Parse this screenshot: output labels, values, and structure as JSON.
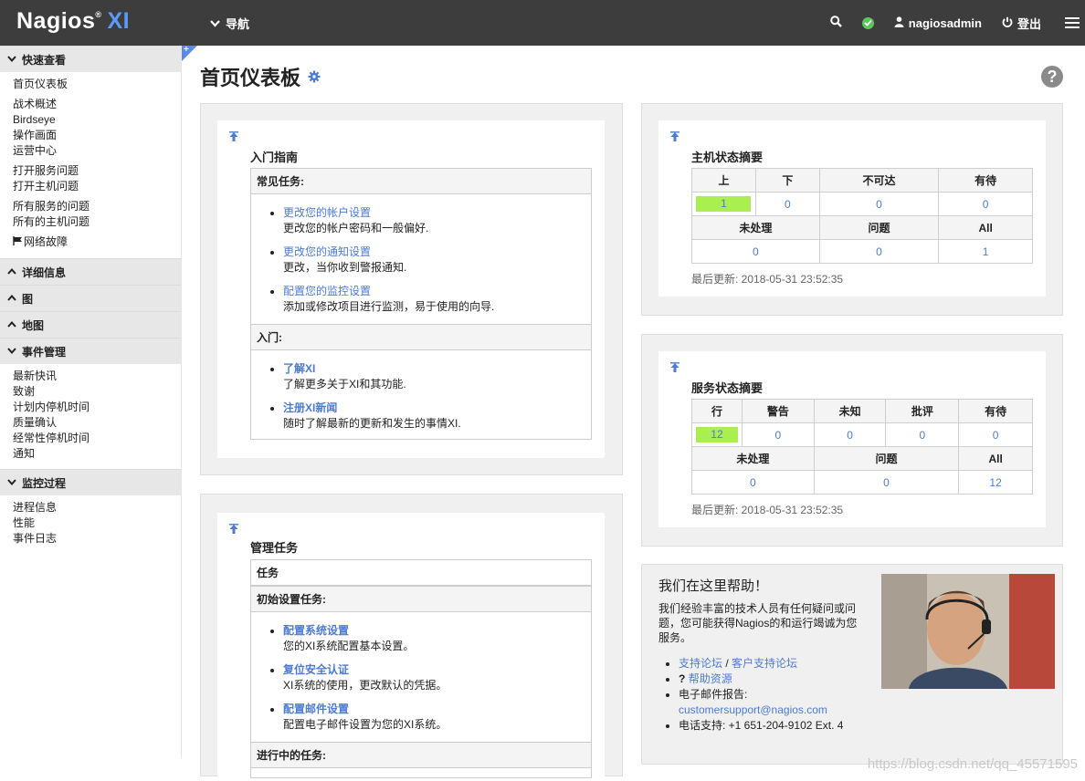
{
  "topbar": {
    "logo_main": "Nagios",
    "logo_reg": "®",
    "logo_xi": "XI",
    "nav_label": "导航",
    "user": "nagiosadmin",
    "logout": "登出"
  },
  "sidebar": {
    "quickview": {
      "title": "快速查看",
      "items": [
        "首页仪表板",
        "战术概述",
        "Birdseye",
        "操作画面",
        "运营中心",
        "打开服务问题",
        "打开主机问题",
        "所有服务的问题",
        "所有的主机问题",
        "网络故障"
      ]
    },
    "details": "详细信息",
    "graphs": "图",
    "maps": "地图",
    "incident": {
      "title": "事件管理",
      "items": [
        "最新快讯",
        "致谢",
        "计划内停机时间",
        "质量确认",
        "经常性停机时间",
        "通知"
      ]
    },
    "monitor": {
      "title": "监控过程",
      "items": [
        "进程信息",
        "性能",
        "事件日志"
      ]
    }
  },
  "main": {
    "page_title": "首页仪表板",
    "getting_started": {
      "title": "入门指南",
      "common_header": "常见任务:",
      "common_tasks": [
        {
          "link": "更改您的帐户设置",
          "desc": "更改您的帐户密码和一般偏好."
        },
        {
          "link": "更改您的通知设置",
          "desc": "更改，当你收到警报通知."
        },
        {
          "link": "配置您的监控设置",
          "desc": "添加或修改项目进行监测，易于使用的向导."
        }
      ],
      "intro_header": "入门:",
      "intro_tasks": [
        {
          "link": "了解XI",
          "desc": "了解更多关于XI和其功能."
        },
        {
          "link": "注册XI新闻",
          "desc": "随时了解最新的更新和发生的事情XI."
        }
      ]
    },
    "admin_tasks": {
      "title": "管理任务",
      "tasks_header": "任务",
      "init_header": "初始设置任务:",
      "init_tasks": [
        {
          "link": "配置系统设置",
          "desc": "您的XI系统配置基本设置。"
        },
        {
          "link": "复位安全认证",
          "desc": "XI系统的使用，更改默认的凭据。"
        },
        {
          "link": "配置邮件设置",
          "desc": "配置电子邮件设置为您的XI系统。"
        }
      ],
      "ongoing_header": "进行中的任务:"
    },
    "host_summary": {
      "title": "主机状态摘要",
      "headers": [
        "上",
        "下",
        "不可达",
        "有待"
      ],
      "values": [
        "1",
        "0",
        "0",
        "0"
      ],
      "headers2": [
        "未处理",
        "问题",
        "All"
      ],
      "values2": [
        "0",
        "0",
        "1"
      ],
      "last_update": "最后更新: 2018-05-31 23:52:35"
    },
    "service_summary": {
      "title": "服务状态摘要",
      "headers": [
        "行",
        "警告",
        "未知",
        "批评",
        "有待"
      ],
      "values": [
        "12",
        "0",
        "0",
        "0",
        "0"
      ],
      "headers2": [
        "未处理",
        "问题",
        "All"
      ],
      "values2": [
        "0",
        "0",
        "12"
      ],
      "last_update": "最后更新: 2018-05-31 23:52:35"
    },
    "help": {
      "title": "我们在这里帮助！",
      "text": "我们经验丰富的技术人员有任何疑问或问题，您可能获得Nagios的和运行竭诚为您服务。",
      "forum": "支持论坛",
      "sep": " / ",
      "customer_forum": "客户支持论坛",
      "resources": "帮助资源",
      "email_label": "电子邮件报告:",
      "email": "customersupport@nagios.com",
      "phone": "电话支持: +1 651-204-9102 Ext. 4"
    },
    "watermark": "https://blog.csdn.net/qq_45571595"
  }
}
